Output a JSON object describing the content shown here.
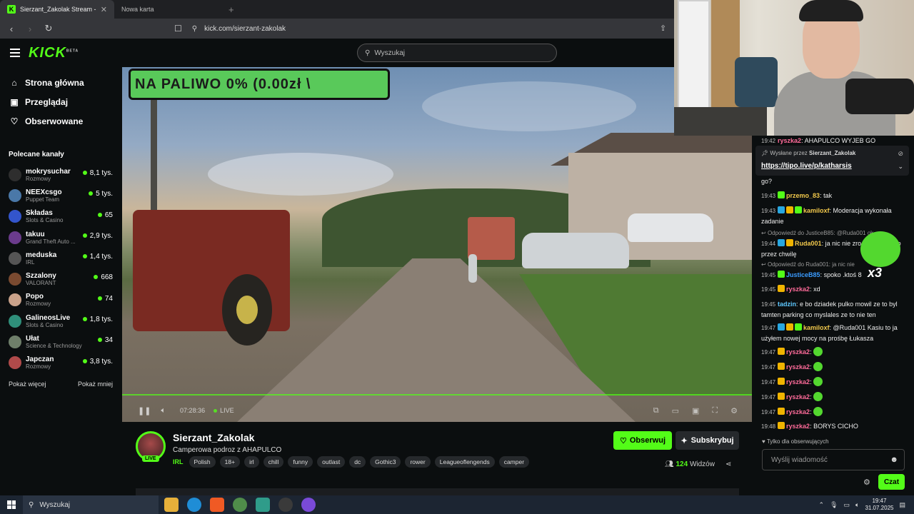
{
  "browser": {
    "active_tab_title": "Sierzant_Zakolak Stream - Wa",
    "inactive_tab_title": "Nowa karta",
    "url": "kick.com/sierzant-zakolak"
  },
  "header": {
    "logo": "KICK",
    "logo_tag": "BETA",
    "search_placeholder": "Wyszukaj"
  },
  "sidebar": {
    "nav": [
      {
        "label": "Strona główna",
        "icon": "home-icon"
      },
      {
        "label": "Przeglądaj",
        "icon": "browse-icon"
      },
      {
        "label": "Obserwowane",
        "icon": "heart-icon"
      }
    ],
    "recommended_title": "Polecane kanały",
    "channels": [
      {
        "name": "mokrysuchar",
        "category": "Rozmowy",
        "viewers": "8,1 tys.",
        "color": "#2e2e2e"
      },
      {
        "name": "NEEXcsgo",
        "category": "Puppet Team",
        "viewers": "5 tys.",
        "color": "#4a78a8"
      },
      {
        "name": "Składas",
        "category": "Slots & Casino",
        "viewers": "65",
        "color": "#3355cc"
      },
      {
        "name": "takuu",
        "category": "Grand Theft Auto ...",
        "viewers": "2,9 tys.",
        "color": "#6b3b8c"
      },
      {
        "name": "meduska",
        "category": "IRL",
        "viewers": "1,4 tys.",
        "color": "#555555"
      },
      {
        "name": "Szzalony",
        "category": "VALORANT",
        "viewers": "668",
        "color": "#7a4a30"
      },
      {
        "name": "Popo",
        "category": "Rozmowy",
        "viewers": "74",
        "color": "#c9a28a"
      },
      {
        "name": "GalineosLive",
        "category": "Slots & Casino",
        "viewers": "1,8 tys.",
        "color": "#2f8f7a"
      },
      {
        "name": "Ułat",
        "category": "Science & Technology",
        "viewers": "34",
        "color": "#6f7f6a"
      },
      {
        "name": "Japczan",
        "category": "Rozmowy",
        "viewers": "3,8 tys.",
        "color": "#b04a4a"
      }
    ],
    "show_more": "Pokaż więcej",
    "show_less": "Pokaż mniej"
  },
  "video": {
    "overlay_text": "NA PALIWO 0% (0.00zł \\",
    "time": "07:28:36",
    "live": "LIVE"
  },
  "stream": {
    "live_badge": "LIVE",
    "streamer": "Sierzant_Zakolak",
    "title": "Camperowa podroz z AHAPULCO",
    "category": "IRL",
    "tags": [
      "Polish",
      "18+",
      "irl",
      "chill",
      "funny",
      "outlast",
      "dc",
      "Gothic3",
      "rower",
      "Leagueoflengends",
      "camper"
    ],
    "follow": "Obserwuj",
    "subscribe": "Subskrybuj",
    "viewers_count": "124",
    "viewers_label": "Widzów"
  },
  "chat": {
    "top_cut": {
      "ts": "19:42",
      "user": "ryszka2",
      "text": ": AHAPULCO WYJEB GO"
    },
    "pinned_by_label": "Wysłane przez",
    "pinned_by_user": "Sierzant_Zakolak",
    "pinned_link": "https://tipo.live/p/katharsis",
    "messages": [
      {
        "text": "go?"
      },
      {
        "ts": "19:43",
        "user": "przemo_83",
        "color": "#f2c94c",
        "text": ": tak"
      },
      {
        "ts": "19:43",
        "user": "kamiloxf",
        "color": "#f2c94c",
        "text": ": Moderacja wykonała zadanie"
      },
      {
        "reply": "Odpowiedź do JusticeB85: @Ruda001 ok"
      },
      {
        "ts": "19:44",
        "user": "Ruda001",
        "color": "#f2c94c",
        "text": ": ja nic nie zro mnie nie było przez chwilę"
      },
      {
        "reply": "Odpowiedź do Ruda001: ja nic nie"
      },
      {
        "ts": "19:45",
        "user": "JusticeB85",
        "color": "#3b9cff",
        "text": ": spoko .ktoś 8"
      },
      {
        "ts": "19:45",
        "user": "ryszka2",
        "color": "#ff6b9a",
        "text": ": xd"
      },
      {
        "ts": "19:45",
        "user": "tadzin",
        "color": "#5ec8ff",
        "text": ": e bo dziadek pulko mowil ze to byl tamten parking co myslales ze to nie ten"
      },
      {
        "ts": "19:47",
        "user": "kamiloxf",
        "color": "#f2c94c",
        "text": ": @Ruda001 Kasiu to ja użyłem nowej mocy na prośbę Łukasza"
      },
      {
        "ts": "19:47",
        "user": "ryszka2",
        "color": "#ff6b9a",
        "text": ":"
      },
      {
        "ts": "19:47",
        "user": "ryszka2",
        "color": "#ff6b9a",
        "text": ":"
      },
      {
        "ts": "19:47",
        "user": "ryszka2",
        "color": "#ff6b9a",
        "text": ":"
      },
      {
        "ts": "19:47",
        "user": "ryszka2",
        "color": "#ff6b9a",
        "text": ":"
      },
      {
        "ts": "19:47",
        "user": "ryszka2",
        "color": "#ff6b9a",
        "text": ":"
      },
      {
        "ts": "19:48",
        "user": "ryszka2",
        "color": "#ff6b9a",
        "text": ": BORYS CICHO"
      }
    ],
    "emote_overlay": "x3",
    "followers_only": "Tylko dla obserwujących",
    "input_placeholder": "Wyślij wiadomość",
    "send": "Czat"
  },
  "taskbar": {
    "search": "Wyszukaj",
    "time": "19:47",
    "date": "31.07.2025"
  }
}
